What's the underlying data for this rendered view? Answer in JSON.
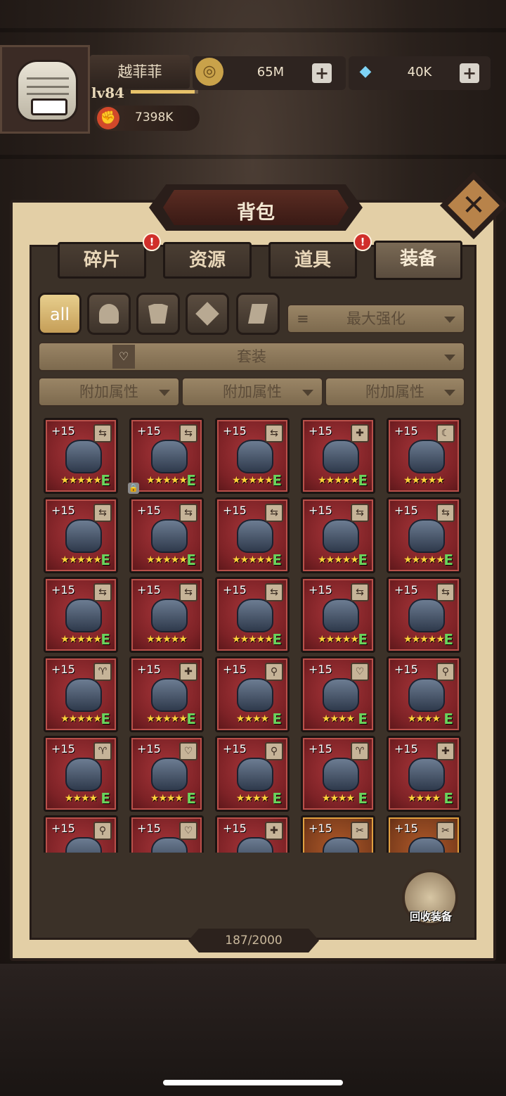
{
  "player": {
    "name": "越菲菲",
    "level": "lv84",
    "power": "7398K",
    "xp_fraction": 0.95
  },
  "currency": {
    "gold": "65M",
    "diamond": "40K"
  },
  "bag": {
    "title": "背包",
    "tabs": [
      {
        "label": "碎片",
        "alert": "!"
      },
      {
        "label": "资源",
        "alert": ""
      },
      {
        "label": "道具",
        "alert": "!"
      },
      {
        "label": "装备",
        "alert": ""
      }
    ],
    "filters": [
      "all",
      "helmet-icon",
      "armor-icon",
      "weapon-icon",
      "boots-icon"
    ],
    "sort": "最大强化",
    "set_filter": "套装",
    "attr_filters": [
      "附加属性",
      "附加属性",
      "附加属性"
    ],
    "recycle_label": "回收装备",
    "count": "187/2000"
  },
  "items": [
    {
      "level": "+15",
      "stars": "★★★★★",
      "grade": "E",
      "gold": false
    },
    {
      "level": "+15",
      "stars": "★★★★★",
      "grade": "E",
      "gold": false
    },
    {
      "level": "+15",
      "stars": "★★★★★",
      "grade": "E",
      "gold": false
    },
    {
      "level": "+15",
      "stars": "★★★★★",
      "grade": "E",
      "gold": false
    },
    {
      "level": "+15",
      "stars": "★★★★★",
      "grade": "",
      "gold": false
    },
    {
      "level": "+15",
      "stars": "★★★★★",
      "grade": "E",
      "gold": false
    },
    {
      "level": "+15",
      "stars": "★★★★★",
      "grade": "E",
      "gold": false
    },
    {
      "level": "+15",
      "stars": "★★★★★",
      "grade": "E",
      "gold": false
    },
    {
      "level": "+15",
      "stars": "★★★★★",
      "grade": "E",
      "gold": false
    },
    {
      "level": "+15",
      "stars": "★★★★★",
      "grade": "E",
      "gold": false
    },
    {
      "level": "+15",
      "stars": "★★★★★",
      "grade": "E",
      "gold": false
    },
    {
      "level": "+15",
      "stars": "★★★★★",
      "grade": "",
      "gold": false
    },
    {
      "level": "+15",
      "stars": "★★★★★",
      "grade": "E",
      "gold": false
    },
    {
      "level": "+15",
      "stars": "★★★★★",
      "grade": "E",
      "gold": false
    },
    {
      "level": "+15",
      "stars": "★★★★★",
      "grade": "E",
      "gold": false
    },
    {
      "level": "+15",
      "stars": "★★★★★",
      "grade": "E",
      "gold": false
    },
    {
      "level": "+15",
      "stars": "★★★★★",
      "grade": "E",
      "gold": false
    },
    {
      "level": "+15",
      "stars": "★★★★",
      "grade": "E",
      "gold": false
    },
    {
      "level": "+15",
      "stars": "★★★★",
      "grade": "E",
      "gold": false
    },
    {
      "level": "+15",
      "stars": "★★★★",
      "grade": "E",
      "gold": false
    },
    {
      "level": "+15",
      "stars": "★★★★",
      "grade": "E",
      "gold": false
    },
    {
      "level": "+15",
      "stars": "★★★★",
      "grade": "E",
      "gold": false
    },
    {
      "level": "+15",
      "stars": "★★★★",
      "grade": "E",
      "gold": false
    },
    {
      "level": "+15",
      "stars": "★★★★",
      "grade": "E",
      "gold": false
    },
    {
      "level": "+15",
      "stars": "★★★★",
      "grade": "E",
      "gold": false
    },
    {
      "level": "+15",
      "stars": "",
      "grade": "",
      "gold": false
    },
    {
      "level": "+15",
      "stars": "",
      "grade": "",
      "gold": false
    },
    {
      "level": "+15",
      "stars": "",
      "grade": "",
      "gold": false
    },
    {
      "level": "+15",
      "stars": "",
      "grade": "",
      "gold": true
    },
    {
      "level": "+15",
      "stars": "",
      "grade": "",
      "gold": true
    }
  ]
}
